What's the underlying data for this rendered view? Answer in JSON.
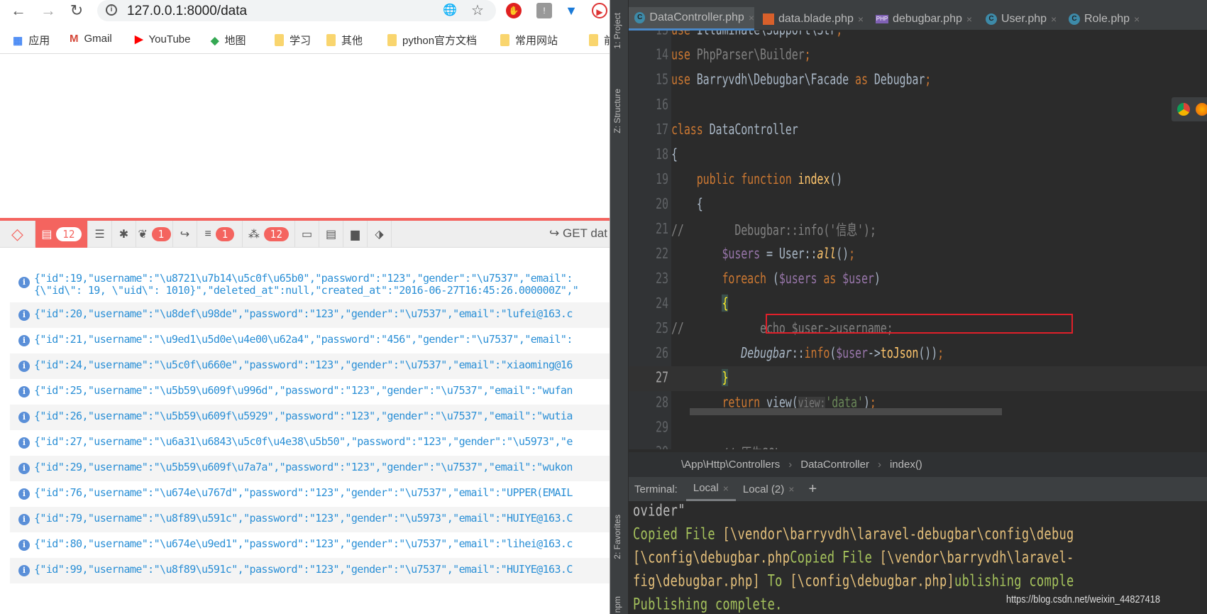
{
  "browser": {
    "url": "127.0.0.1:8000/data",
    "bookmarks": [
      {
        "label": "应用",
        "icon": "apps-grid-icon"
      },
      {
        "label": "Gmail",
        "icon": "gmail-icon"
      },
      {
        "label": "YouTube",
        "icon": "youtube-icon"
      },
      {
        "label": "地图",
        "icon": "maps-icon"
      },
      {
        "label": "学习",
        "icon": "folder-icon"
      },
      {
        "label": "其他",
        "icon": "folder-icon"
      },
      {
        "label": "python官方文档",
        "icon": "folder-icon"
      },
      {
        "label": "常用网站",
        "icon": "folder-icon"
      },
      {
        "label": "前",
        "icon": "folder-icon"
      }
    ]
  },
  "debugbar": {
    "accent": "#f4645f",
    "tabs": [
      {
        "icon": "messages-icon",
        "badge": "12",
        "active": true
      },
      {
        "icon": "timeline-icon"
      },
      {
        "icon": "exceptions-bug-icon"
      },
      {
        "icon": "views-leaf-icon",
        "badge": "1"
      },
      {
        "icon": "route-icon"
      },
      {
        "icon": "queries-database-icon",
        "badge": "1"
      },
      {
        "icon": "models-cubes-icon",
        "badge": "12"
      },
      {
        "icon": "mail-inbox-icon"
      },
      {
        "icon": "gate-list-icon"
      },
      {
        "icon": "session-archive-icon"
      },
      {
        "icon": "request-tags-icon"
      }
    ],
    "method": "GET dat",
    "messages": [
      "{\"id\":19,\"username\":\"\\u8721\\u7b14\\u5c0f\\u65b0\",\"password\":\"123\",\"gender\":\"\\u7537\",\"email\":",
      "{\"id\":20,\"username\":\"\\u8def\\u98de\",\"password\":\"123\",\"gender\":\"\\u7537\",\"email\":\"lufei@163.c",
      "{\"id\":21,\"username\":\"\\u9ed1\\u5d0e\\u4e00\\u62a4\",\"password\":\"456\",\"gender\":\"\\u7537\",\"email\":",
      "{\"id\":24,\"username\":\"\\u5c0f\\u660e\",\"password\":\"123\",\"gender\":\"\\u7537\",\"email\":\"xiaoming@16",
      "{\"id\":25,\"username\":\"\\u5b59\\u609f\\u996d\",\"password\":\"123\",\"gender\":\"\\u7537\",\"email\":\"wufan",
      "{\"id\":26,\"username\":\"\\u5b59\\u609f\\u5929\",\"password\":\"123\",\"gender\":\"\\u7537\",\"email\":\"wutia",
      "{\"id\":27,\"username\":\"\\u6a31\\u6843\\u5c0f\\u4e38\\u5b50\",\"password\":\"123\",\"gender\":\"\\u5973\",\"e",
      "{\"id\":29,\"username\":\"\\u5b59\\u609f\\u7a7a\",\"password\":\"123\",\"gender\":\"\\u7537\",\"email\":\"wukon",
      "{\"id\":76,\"username\":\"\\u674e\\u767d\",\"password\":\"123\",\"gender\":\"\\u7537\",\"email\":\"UPPER(EMAIL",
      "{\"id\":79,\"username\":\"\\u8f89\\u591c\",\"password\":\"123\",\"gender\":\"\\u5973\",\"email\":\"HUIYE@163.C",
      "{\"id\":80,\"username\":\"\\u674e\\u9ed1\",\"password\":\"123\",\"gender\":\"\\u7537\",\"email\":\"lihei@163.c",
      "{\"id\":99,\"username\":\"\\u8f89\\u591c\",\"password\":\"123\",\"gender\":\"\\u7537\",\"email\":\"HUIYE@163.C"
    ],
    "first_message_line2": "{\\\"id\\\": 19, \\\"uid\\\": 1010}\",\"deleted_at\":null,\"created_at\":\"2016-06-27T16:45:26.000000Z\",\""
  },
  "ide": {
    "side_labels": {
      "project": "1: Project",
      "structure": "Z: Structure",
      "favorites": "2: Favorites",
      "npm": "npm"
    },
    "tabs": [
      {
        "label": "DataController.php",
        "icon": "php-class-icon",
        "active": true
      },
      {
        "label": "data.blade.php",
        "icon": "blade-file-icon"
      },
      {
        "label": "debugbar.php",
        "icon": "php-file-icon"
      },
      {
        "label": "User.php",
        "icon": "php-class-icon"
      },
      {
        "label": "Role.php",
        "icon": "php-class-icon"
      }
    ],
    "code_lines": [
      {
        "n": "13",
        "tokens": [
          [
            "use ",
            "kw"
          ],
          [
            "Illuminate\\Support\\Str",
            "default"
          ],
          [
            ";",
            "kw"
          ]
        ]
      },
      {
        "n": "14",
        "tokens": [
          [
            "use ",
            "kw"
          ],
          [
            "PhpParser\\Builder",
            "cm"
          ],
          [
            ";",
            "kw"
          ]
        ]
      },
      {
        "n": "15",
        "tokens": [
          [
            "use ",
            "kw"
          ],
          [
            "Barryvdh\\Debugbar\\Facade ",
            "default"
          ],
          [
            "as ",
            "kw"
          ],
          [
            "Debugbar",
            "default"
          ],
          [
            ";",
            "kw"
          ]
        ]
      },
      {
        "n": "16",
        "tokens": []
      },
      {
        "n": "17",
        "tokens": [
          [
            "class ",
            "kw"
          ],
          [
            "DataController",
            "default"
          ]
        ]
      },
      {
        "n": "18",
        "tokens": [
          [
            "{",
            "default"
          ]
        ]
      },
      {
        "n": "19",
        "tokens": [
          [
            "    public function ",
            "kw"
          ],
          [
            "index",
            "fn"
          ],
          [
            "()",
            "default"
          ]
        ]
      },
      {
        "n": "20",
        "tokens": [
          [
            "    {",
            "default"
          ]
        ]
      },
      {
        "n": "21",
        "tokens": [
          [
            "//        ",
            "cm"
          ],
          [
            "Debugbar::info('信息');",
            "cm"
          ]
        ]
      },
      {
        "n": "22",
        "tokens": [
          [
            "        ",
            "default"
          ],
          [
            "$users",
            "var"
          ],
          [
            " = User::",
            "default"
          ],
          [
            "all",
            "fn it"
          ],
          [
            "()",
            "default"
          ],
          [
            ";",
            "kw"
          ]
        ]
      },
      {
        "n": "23",
        "tokens": [
          [
            "        ",
            "default"
          ],
          [
            "foreach ",
            "kw"
          ],
          [
            "(",
            "default"
          ],
          [
            "$users ",
            "var"
          ],
          [
            "as ",
            "kw"
          ],
          [
            "$user",
            "var"
          ],
          [
            ")",
            "default"
          ]
        ]
      },
      {
        "n": "24",
        "tokens": [
          [
            "        ",
            "default"
          ],
          [
            "{",
            "brace"
          ]
        ]
      },
      {
        "n": "25",
        "tokens": [
          [
            "//            ",
            "cm"
          ],
          [
            "echo $user->username;",
            "cm"
          ]
        ]
      },
      {
        "n": "26",
        "tokens": [
          [
            "           ",
            "default"
          ],
          [
            "Debugbar",
            "default it"
          ],
          [
            "::",
            "default"
          ],
          [
            "info",
            "kw"
          ],
          [
            "(",
            "default"
          ],
          [
            "$user",
            "var"
          ],
          [
            "->",
            "default"
          ],
          [
            "toJson",
            "fn"
          ],
          [
            "())",
            "default"
          ],
          [
            ";",
            "kw"
          ]
        ]
      },
      {
        "n": "27",
        "tokens": [
          [
            "        ",
            "default"
          ],
          [
            "}",
            "brace"
          ]
        ],
        "current": true
      },
      {
        "n": "28",
        "tokens": [
          [
            "        ",
            "default"
          ],
          [
            "return ",
            "kw"
          ],
          [
            "view(",
            "default"
          ],
          [
            "view:",
            "hint"
          ],
          [
            "'data'",
            "str"
          ],
          [
            ")",
            "default"
          ],
          [
            ";",
            "kw"
          ]
        ]
      },
      {
        "n": "29",
        "tokens": []
      },
      {
        "n": "30",
        "tokens": [
          [
            "        // 原生SQL",
            "cm"
          ]
        ]
      }
    ],
    "breadcrumb": [
      "\\App\\Http\\Controllers",
      "DataController",
      "index()"
    ],
    "terminal": {
      "label": "Terminal:",
      "tabs": [
        "Local",
        "Local (2)"
      ],
      "add": "+",
      "lines": [
        [
          [
            "ovider\"",
            "plain"
          ]
        ],
        [
          [
            "Copied File ",
            "green"
          ],
          [
            "[\\vendor\\barryvdh\\laravel-debugbar\\config\\debug",
            "yellow"
          ]
        ],
        [
          [
            "[\\config\\debugbar.php",
            "yellow"
          ],
          [
            "Copied File ",
            "green"
          ],
          [
            "[\\vendor\\barryvdh\\laravel-",
            "yellow"
          ]
        ],
        [
          [
            "fig\\debugbar.php] ",
            "yellow"
          ],
          [
            "To ",
            "green"
          ],
          [
            "[\\config\\debugbar.php]",
            "yellow"
          ],
          [
            "ublishing comple",
            "green"
          ]
        ],
        [
          [
            "Publishing complete.",
            "green"
          ]
        ]
      ]
    }
  },
  "watermark": "https://blog.csdn.net/weixin_44827418"
}
